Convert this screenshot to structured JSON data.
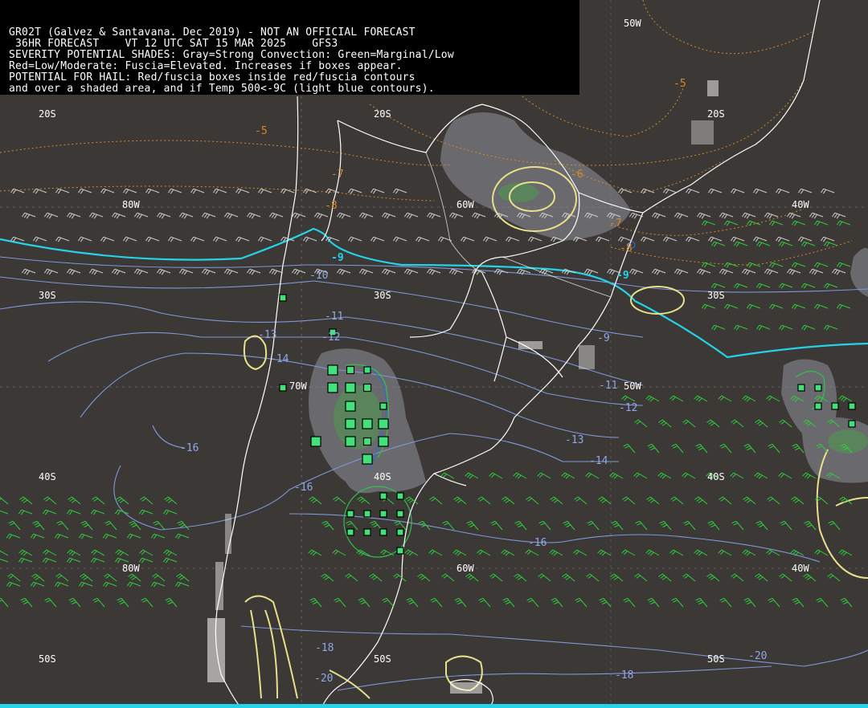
{
  "header": {
    "lines": [
      "GR02T (Galvez & Santavana. Dec 2019) - NOT AN OFFICIAL FORECAST",
      " 36HR FORECAST    VT 12 UTC SAT 15 MAR 2025    GFS3",
      "SEVERITY POTENTIAL SHADES: Gray=Strong Convection: Green=Marginal/Low",
      "Red=Low/Moderate: Fuscia=Elevated. Increases if boxes appear.",
      "POTENTIAL FOR HAIL: Red/fuscia boxes inside red/fuscia contours",
      "and over a shaded area, and if Temp 500<-9C (light blue contours)."
    ]
  },
  "grid": {
    "lat_labels": [
      "20S",
      "20S",
      "20S",
      "30S",
      "30S",
      "30S",
      "40S",
      "40S",
      "40S",
      "50S",
      "50S",
      "50S"
    ],
    "lon_labels": [
      "50W",
      "80W",
      "60W",
      "40W",
      "70W",
      "50W",
      "80W",
      "60W",
      "40W"
    ]
  },
  "isotherm_labels": [
    "-9",
    "-9",
    "-10",
    "-11",
    "-12",
    "-13",
    "-14",
    "-11",
    "-12",
    "-13",
    "-14",
    "-16",
    "-16",
    "-16",
    "-18",
    "-18",
    "-20",
    "-20",
    "-8",
    "-9"
  ],
  "geopotential_labels": [
    "-5",
    "-5",
    "-6",
    "-7",
    "-7",
    "-8"
  ],
  "colors": {
    "background": "#3b3835",
    "coast": "#ffffff",
    "isotherm": "#7f98d8",
    "isotherm_hail": "#25d3e8",
    "geopotential": "#d58a2a",
    "gray_shade": "#6c6b72",
    "green_shade": "#4e9a4e",
    "box_green": "#45e07a",
    "cape": "#e8e08a",
    "barb_white": "#cfcfcf",
    "barb_green": "#2fcf3f"
  }
}
